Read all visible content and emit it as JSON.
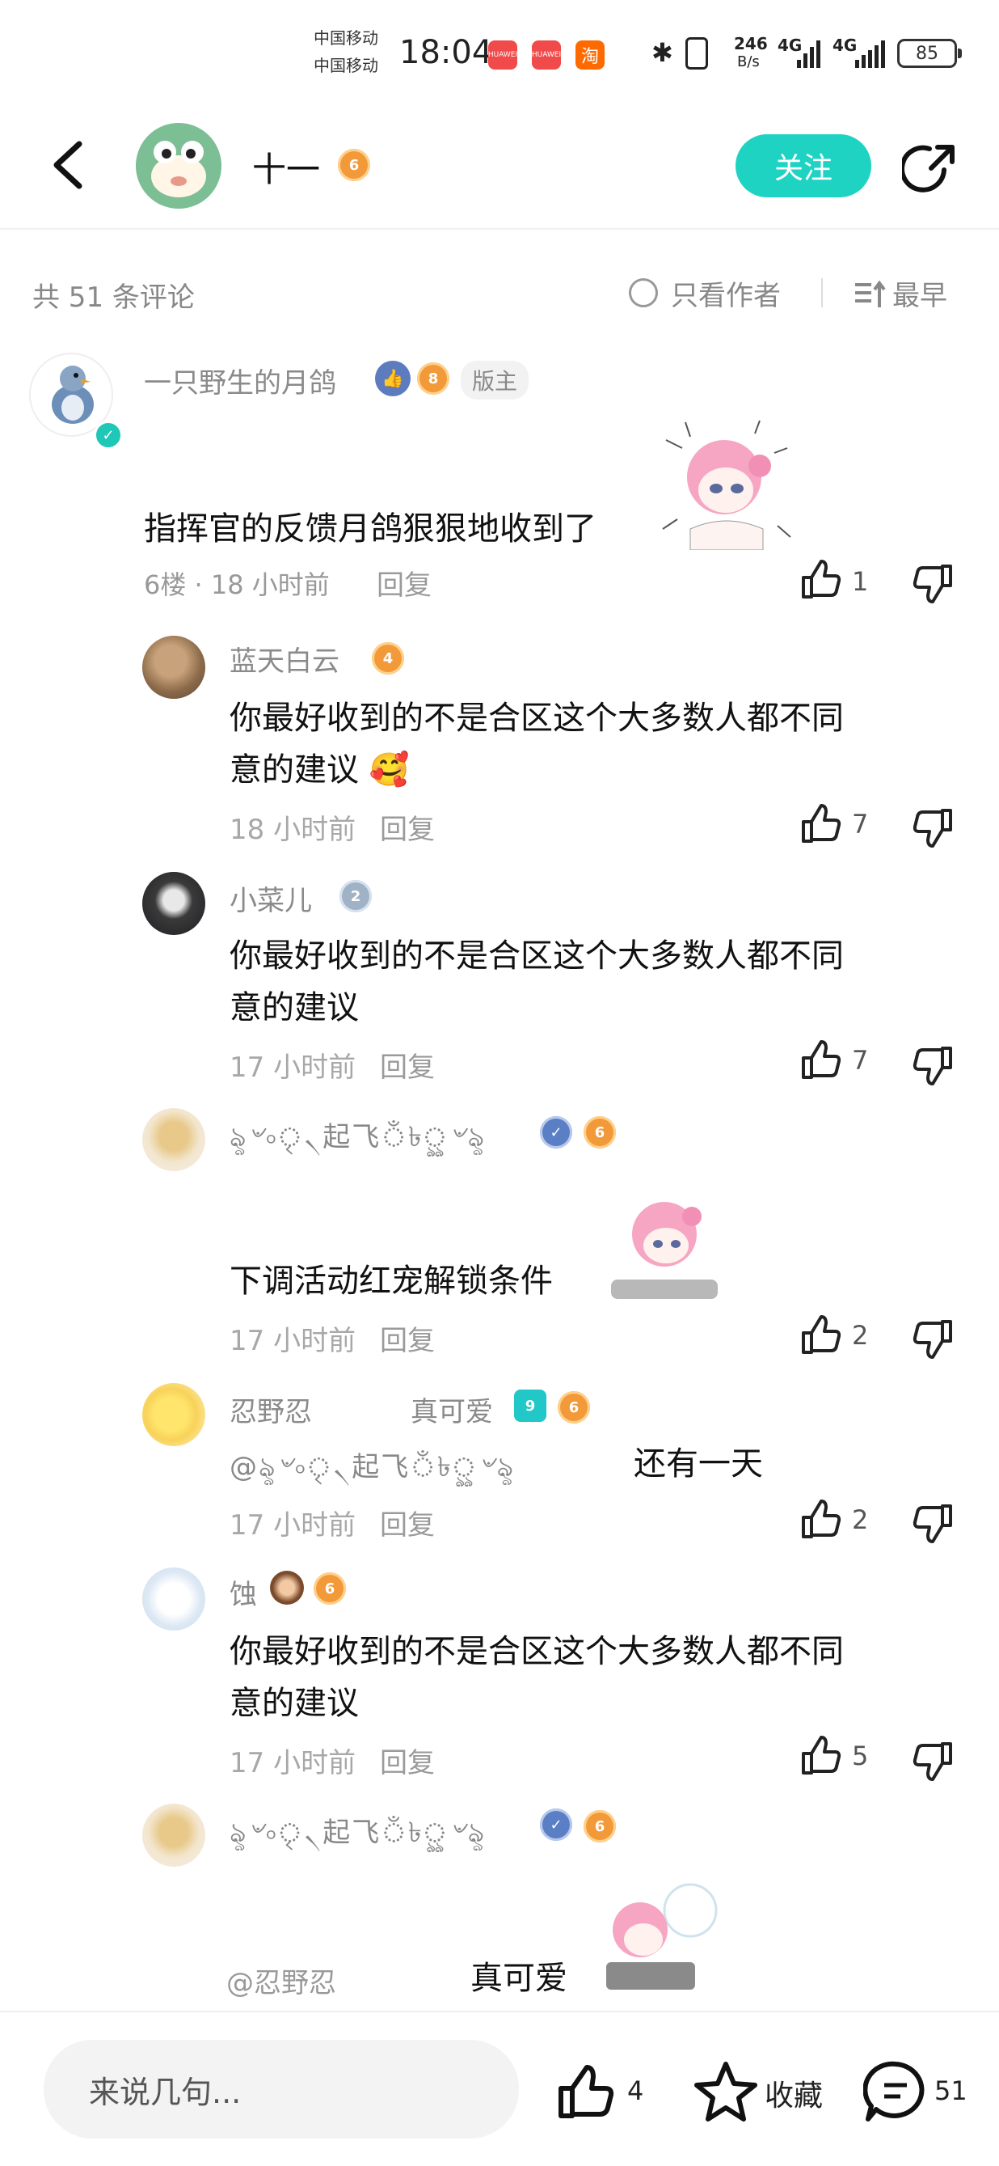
{
  "status_bar": {
    "carrier1": "中国移动",
    "carrier2": "中国移动",
    "time": "18:04",
    "apps": [
      {
        "name": "HUAWEI",
        "color": "#f04a4a"
      },
      {
        "name": "HUAWEI",
        "color": "#f04a4a"
      },
      {
        "name": "淘",
        "color": "#ff6a00"
      }
    ],
    "net_speed_top": "246",
    "net_speed_bottom": "B/s",
    "signal1": "4G",
    "signal2": "4G",
    "battery": "85"
  },
  "header": {
    "name": "十一",
    "level_badge": "6",
    "follow_label": "关注"
  },
  "comments_bar": {
    "count": "共 51 条评论",
    "author_only": "只看作者",
    "sort": "最早"
  },
  "main_comment": {
    "user": "一只野生的月鸽",
    "level": "8",
    "tag": "版主",
    "text": "指挥官的反馈月鸽狠狠地收到了",
    "meta": "6楼 · 18 小时前",
    "reply": "回复",
    "likes": "1"
  },
  "replies": [
    {
      "user": "蓝天白云",
      "level": "4",
      "text_line1": "你最好收到的不是合区这个大多数人都不同",
      "text_line2": "意的建议",
      "time": "18 小时前",
      "reply": "回复",
      "likes": "7"
    },
    {
      "user": "小菜儿",
      "level": "2",
      "text_line1": "你最好收到的不是合区这个大多数人都不同",
      "text_line2": "意的建议",
      "time": "17 小时前",
      "reply": "回复",
      "likes": "7"
    },
    {
      "user": "ৡ৺৹ৃ৲起飞ঁ৳ৣ৺ৡ",
      "level": "6",
      "text_line1": "下调活动红宠解锁条件",
      "time": "17 小时前",
      "reply": "回复",
      "likes": "2"
    },
    {
      "user": "忍野忍",
      "user_extra": "真可爱",
      "level": "6",
      "teal_badge": "9",
      "text_mention": "@ৡ৺৹ৃ৲起飞ঁ৳ৣ৺ৡ",
      "text_line1": "还有一天",
      "time": "17 小时前",
      "reply": "回复",
      "likes": "2"
    },
    {
      "user": "蚀",
      "level": "6",
      "text_line1": "你最好收到的不是合区这个大多数人都不同",
      "text_line2": "意的建议",
      "time": "17 小时前",
      "reply": "回复",
      "likes": "5"
    },
    {
      "user": "ৡ৺৹ৃ৲起飞ঁ৳ৣ৺ৡ",
      "level": "6",
      "text_mention": "@忍野忍",
      "text_line1": "真可爱"
    }
  ],
  "bottom_bar": {
    "placeholder": "来说几句...",
    "likes": "4",
    "collect": "收藏",
    "comments": "51"
  }
}
